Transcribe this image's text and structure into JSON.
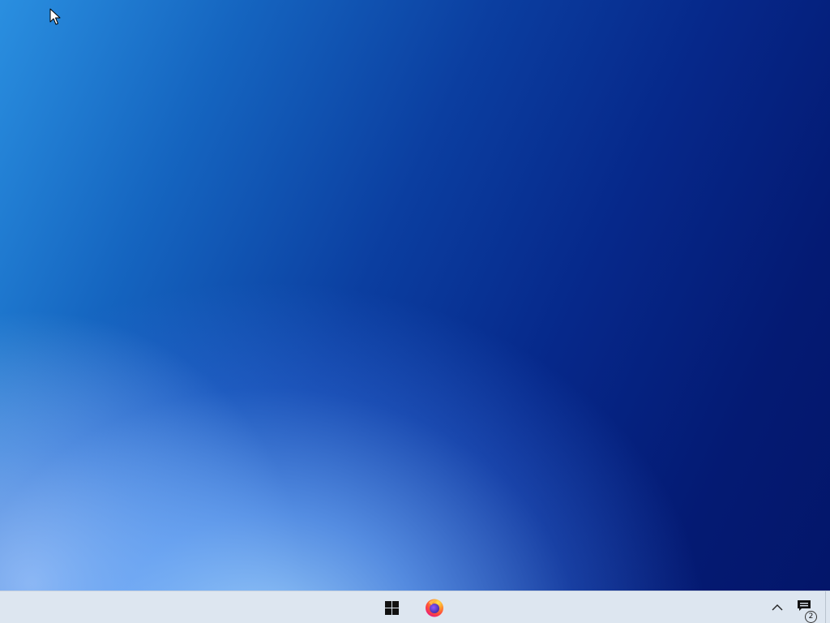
{
  "desktop": {
    "wallpaper": "blue-gradient-wallpaper"
  },
  "taskbar": {
    "items": [
      {
        "name": "start",
        "icon": "windows-logo-icon"
      },
      {
        "name": "firefox",
        "icon": "firefox-icon"
      }
    ],
    "tray": {
      "chevron_icon": "chevron-up-icon",
      "notifications_icon": "notification-icon",
      "notification_count": "2"
    }
  },
  "colors": {
    "taskbar_bg": "#dde6f0",
    "wallpaper_dark": "#03166a",
    "wallpaper_light": "#a0d2ff",
    "windows_logo": "#111111",
    "firefox_orange": "#ff7139",
    "firefox_purple": "#7542e5"
  }
}
